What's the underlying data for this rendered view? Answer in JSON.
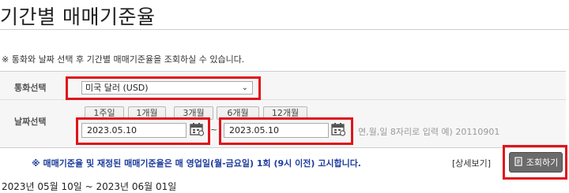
{
  "page": {
    "title": "기간별 매매기준율",
    "notice": "※ 통화와 날짜 선택 후 기간별 매매기준율을 조회하실 수 있습니다."
  },
  "form": {
    "currency_label": "통화선택",
    "currency_selected": "미국 달러 (USD)",
    "date_label": "날짜선택",
    "period_buttons": [
      "1주일",
      "1개월",
      "3개월",
      "6개월",
      "12개월"
    ],
    "start_date": "2023.05.10",
    "end_date": "2023.05.10",
    "range_separator": "~",
    "date_hint": "연,월,일 8자리로 입력 예) 20110901"
  },
  "footer": {
    "info": "※ 매매기준율 및 재정된 매매기준율은 매 영업일(월-금요일) 1회 (9시 이전) 고시합니다.",
    "detail_link": "[상세보기]",
    "search_button": "조회하기"
  },
  "result": {
    "range_text": "2023년 05월 10일 ~ 2023년 06월 01일"
  },
  "colors": {
    "highlight": "#e0141b",
    "info_text": "#1d3d9c",
    "button_bg": "#6b6b6b"
  },
  "icons": [
    "calendar-icon",
    "chevron-down-icon",
    "document-icon"
  ]
}
